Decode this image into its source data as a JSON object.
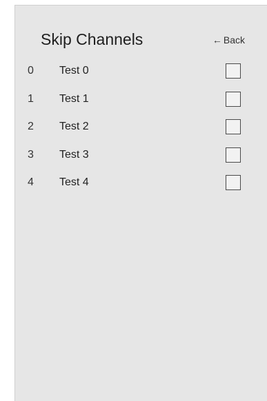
{
  "header": {
    "title": "Skip Channels",
    "back_arrow": "←",
    "back_label": "Back"
  },
  "channels": [
    {
      "number": "0",
      "name": "Test 0",
      "skipped": false
    },
    {
      "number": "1",
      "name": "Test 1",
      "skipped": false
    },
    {
      "number": "2",
      "name": "Test 2",
      "skipped": false
    },
    {
      "number": "3",
      "name": "Test 3",
      "skipped": false
    },
    {
      "number": "4",
      "name": "Test 4",
      "skipped": false
    }
  ]
}
